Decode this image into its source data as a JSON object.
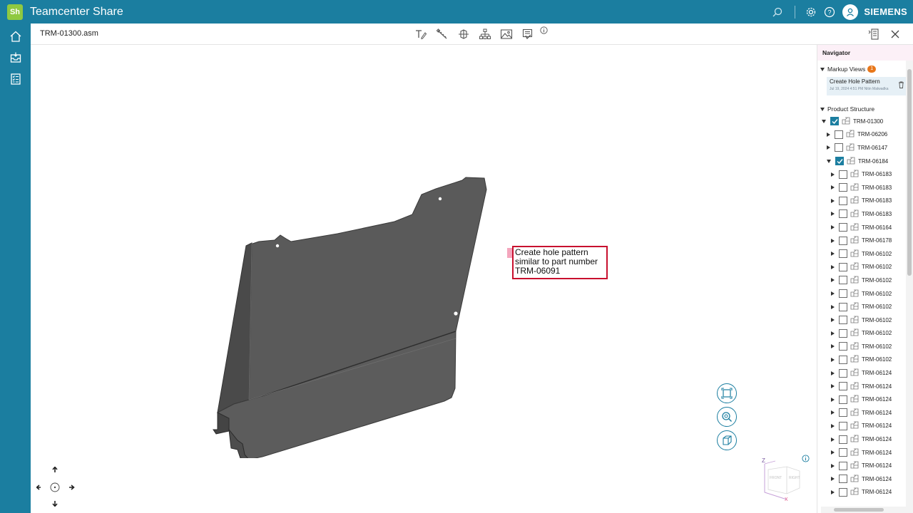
{
  "app": {
    "logo_text": "Sh",
    "title": "Teamcenter Share",
    "brand": "SIEMENS",
    "accent_color": "#1b7ea0"
  },
  "topbar_icons": [
    "search-icon",
    "gear-icon",
    "help-icon",
    "user-icon"
  ],
  "left_rail": [
    "home-icon",
    "inbox-icon",
    "checklist-icon"
  ],
  "document": {
    "title": "TRM-01300.asm"
  },
  "toolbar": [
    "markup-text-icon",
    "measure-icon",
    "section-icon",
    "structure-icon",
    "snapshot-icon",
    "save-view-icon",
    "info-icon"
  ],
  "markup": {
    "text": "Create hole pattern similar to part number TRM-06091",
    "border_color": "#c8102e"
  },
  "navigator": {
    "title": "Navigator",
    "markup_views_label": "Markup Views",
    "markup_views_count": "1",
    "markup_item_name": "Create Hole Pattern",
    "markup_item_meta": "Jul 19, 2024 4:51 PM Nitin Malwadka",
    "product_structure_label": "Product Structure",
    "tree": [
      {
        "label": "TRM-01300",
        "level": 0,
        "expanded": true,
        "checked": true
      },
      {
        "label": "TRM-06206",
        "level": 1,
        "expanded": false,
        "checked": false
      },
      {
        "label": "TRM-06147",
        "level": 1,
        "expanded": false,
        "checked": false
      },
      {
        "label": "TRM-06184",
        "level": 1,
        "expanded": true,
        "checked": true
      },
      {
        "label": "TRM-06183",
        "level": 2,
        "expanded": false,
        "checked": false
      },
      {
        "label": "TRM-06183",
        "level": 2,
        "expanded": false,
        "checked": false
      },
      {
        "label": "TRM-06183",
        "level": 2,
        "expanded": false,
        "checked": false
      },
      {
        "label": "TRM-06183",
        "level": 2,
        "expanded": false,
        "checked": false
      },
      {
        "label": "TRM-06164",
        "level": 2,
        "expanded": false,
        "checked": false
      },
      {
        "label": "TRM-06178",
        "level": 2,
        "expanded": false,
        "checked": false
      },
      {
        "label": "TRM-06102",
        "level": 2,
        "expanded": false,
        "checked": false
      },
      {
        "label": "TRM-06102",
        "level": 2,
        "expanded": false,
        "checked": false
      },
      {
        "label": "TRM-06102",
        "level": 2,
        "expanded": false,
        "checked": false
      },
      {
        "label": "TRM-06102",
        "level": 2,
        "expanded": false,
        "checked": false
      },
      {
        "label": "TRM-06102",
        "level": 2,
        "expanded": false,
        "checked": false
      },
      {
        "label": "TRM-06102",
        "level": 2,
        "expanded": false,
        "checked": false
      },
      {
        "label": "TRM-06102",
        "level": 2,
        "expanded": false,
        "checked": false
      },
      {
        "label": "TRM-06102",
        "level": 2,
        "expanded": false,
        "checked": false
      },
      {
        "label": "TRM-06102",
        "level": 2,
        "expanded": false,
        "checked": false
      },
      {
        "label": "TRM-06124",
        "level": 2,
        "expanded": false,
        "checked": false
      },
      {
        "label": "TRM-06124",
        "level": 2,
        "expanded": false,
        "checked": false
      },
      {
        "label": "TRM-06124",
        "level": 2,
        "expanded": false,
        "checked": false
      },
      {
        "label": "TRM-06124",
        "level": 2,
        "expanded": false,
        "checked": false
      },
      {
        "label": "TRM-06124",
        "level": 2,
        "expanded": false,
        "checked": false
      },
      {
        "label": "TRM-06124",
        "level": 2,
        "expanded": false,
        "checked": false
      },
      {
        "label": "TRM-06124",
        "level": 2,
        "expanded": false,
        "checked": false
      },
      {
        "label": "TRM-06124",
        "level": 2,
        "expanded": false,
        "checked": false
      },
      {
        "label": "TRM-06124",
        "level": 2,
        "expanded": false,
        "checked": false
      },
      {
        "label": "TRM-06124",
        "level": 2,
        "expanded": false,
        "checked": false
      }
    ]
  },
  "view_controls": [
    "fit-all-icon",
    "zoom-icon",
    "view-cube-icon"
  ],
  "triad": {
    "z_label": "Z",
    "front_label": "FRONT",
    "right_label": "RIGHT",
    "x_label": "X"
  }
}
